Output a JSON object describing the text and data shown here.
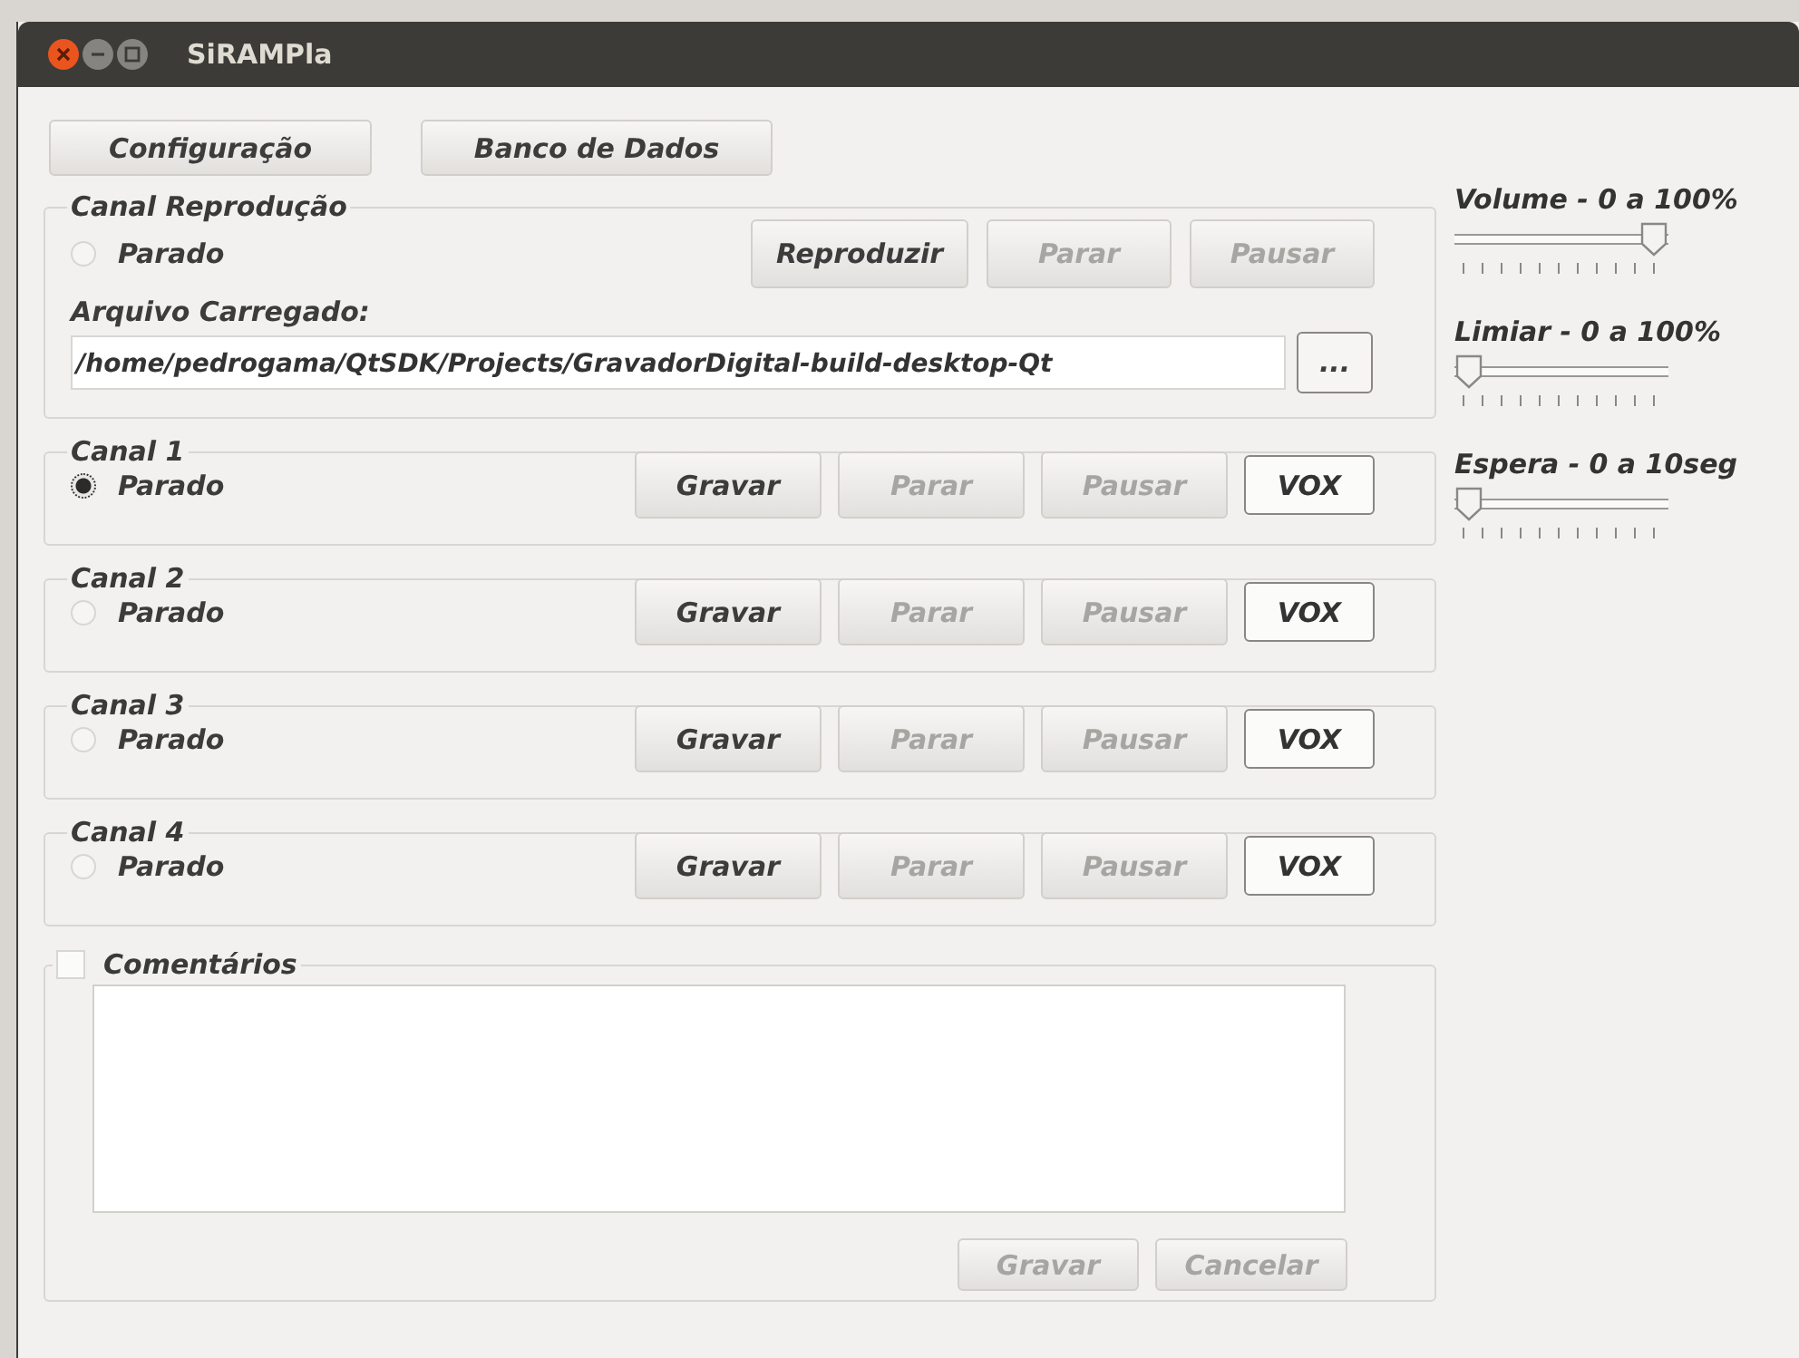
{
  "window": {
    "title": "SiRAMPla"
  },
  "toolbar": [
    {
      "label": "Configuração"
    },
    {
      "label": "Banco de Dados"
    }
  ],
  "playback": {
    "title": "Canal Reprodução",
    "status": {
      "label": "Parado",
      "selected": false
    },
    "buttons": [
      {
        "label": "Reproduzir",
        "disabled": false
      },
      {
        "label": "Parar",
        "disabled": true
      },
      {
        "label": "Pausar",
        "disabled": true
      }
    ],
    "file_label": "Arquivo Carregado:",
    "file_path": "/home/pedrogama/QtSDK/Projects/GravadorDigital-build-desktop-Qt",
    "browse_button": "..."
  },
  "channels": [
    {
      "title": "Canal 1",
      "status": {
        "label": "Parado",
        "selected": true
      },
      "buttons": [
        {
          "label": "Gravar",
          "kind": "push",
          "disabled": false
        },
        {
          "label": "Parar",
          "kind": "push",
          "disabled": true
        },
        {
          "label": "Pausar",
          "kind": "push",
          "disabled": true
        },
        {
          "label": "VOX",
          "kind": "toggle",
          "disabled": false
        }
      ]
    },
    {
      "title": "Canal 2",
      "status": {
        "label": "Parado",
        "selected": false
      },
      "buttons": [
        {
          "label": "Gravar",
          "kind": "push",
          "disabled": false
        },
        {
          "label": "Parar",
          "kind": "push",
          "disabled": true
        },
        {
          "label": "Pausar",
          "kind": "push",
          "disabled": true
        },
        {
          "label": "VOX",
          "kind": "toggle",
          "disabled": false
        }
      ]
    },
    {
      "title": "Canal 3",
      "status": {
        "label": "Parado",
        "selected": false
      },
      "buttons": [
        {
          "label": "Gravar",
          "kind": "push",
          "disabled": false
        },
        {
          "label": "Parar",
          "kind": "push",
          "disabled": true
        },
        {
          "label": "Pausar",
          "kind": "push",
          "disabled": true
        },
        {
          "label": "VOX",
          "kind": "toggle",
          "disabled": false
        }
      ]
    },
    {
      "title": "Canal 4",
      "status": {
        "label": "Parado",
        "selected": false
      },
      "buttons": [
        {
          "label": "Gravar",
          "kind": "push",
          "disabled": false
        },
        {
          "label": "Parar",
          "kind": "push",
          "disabled": true
        },
        {
          "label": "Pausar",
          "kind": "push",
          "disabled": true
        },
        {
          "label": "VOX",
          "kind": "toggle",
          "disabled": false
        }
      ]
    }
  ],
  "comments": {
    "title": "Comentários",
    "checked": false,
    "buttons": [
      {
        "label": "Gravar",
        "disabled": true
      },
      {
        "label": "Cancelar",
        "disabled": true
      }
    ]
  },
  "sliders": [
    {
      "label": "Volume - 0 a 100%",
      "level": 1
    },
    {
      "label": "Limiar - 0 a 100%",
      "level": 0
    },
    {
      "label": "Espera - 0 a 10seg",
      "level": 0
    }
  ]
}
